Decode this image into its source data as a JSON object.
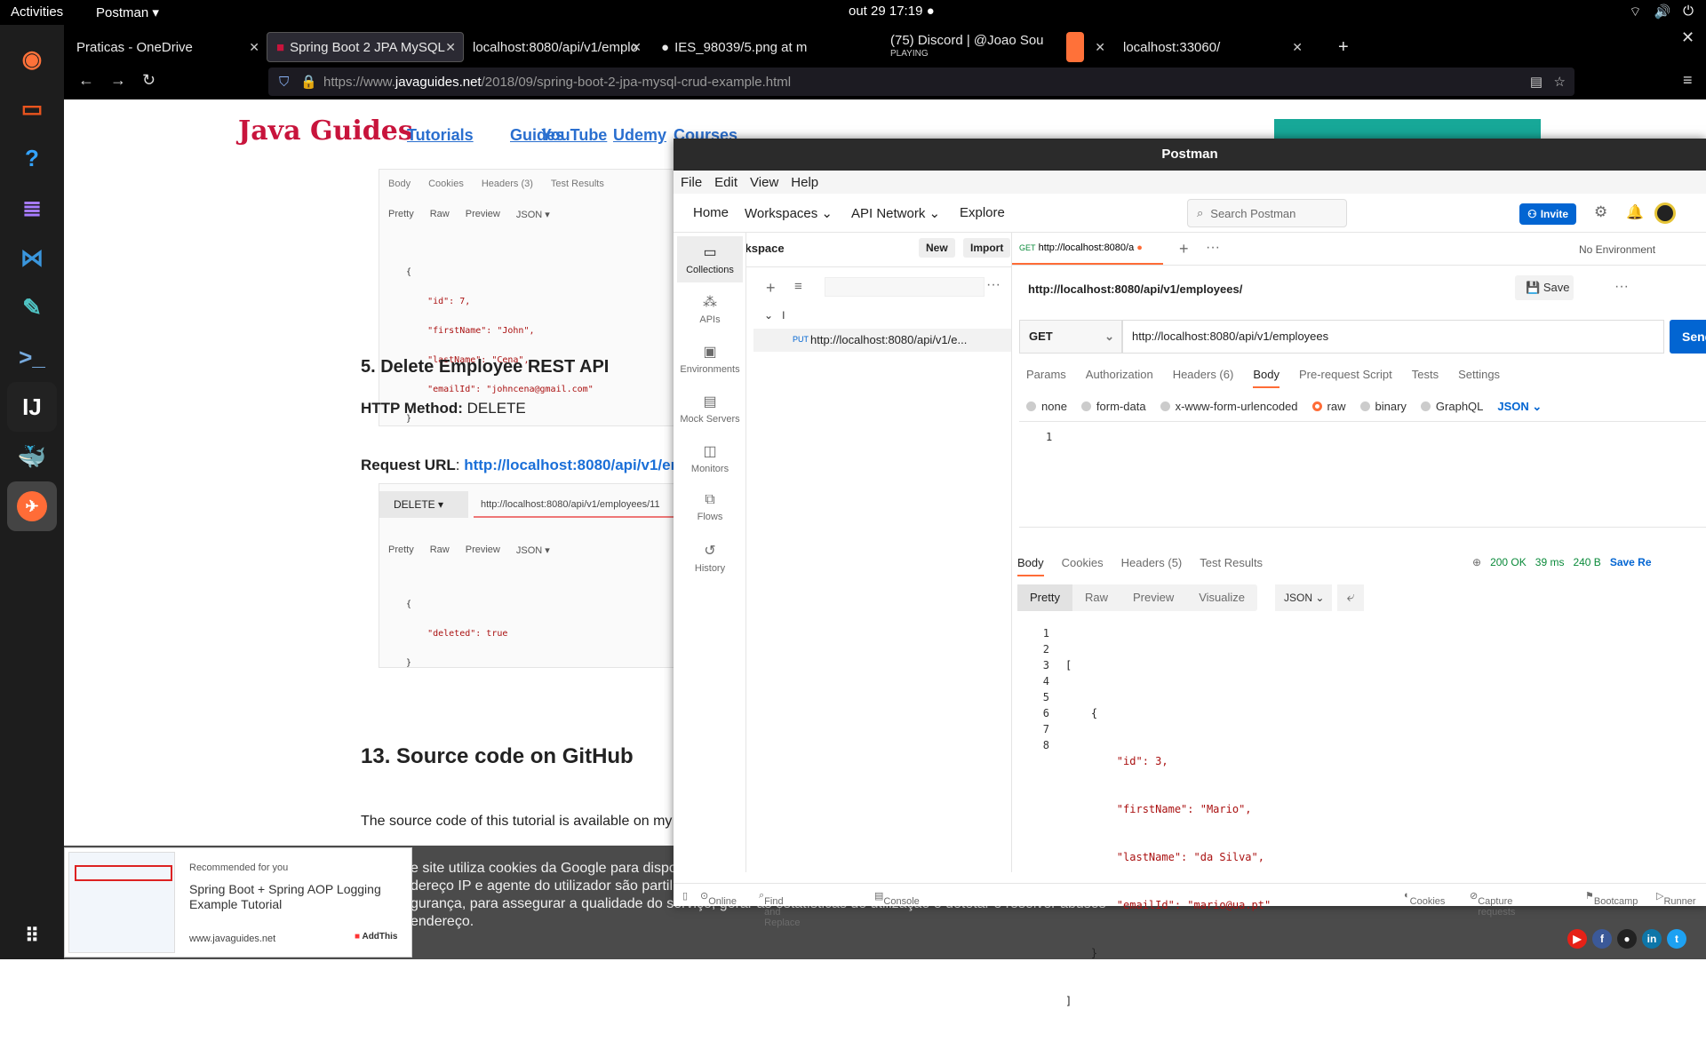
{
  "topbar": {
    "activities": "Activities",
    "app": "Postman ▾",
    "clock": "out 29  17:19  ●"
  },
  "tabs": [
    {
      "label": "Praticas - OneDrive"
    },
    {
      "label": "Spring Boot 2 JPA MySQL"
    },
    {
      "label": "localhost:8080/api/v1/emplo"
    },
    {
      "label": "IES_98039/5.png at m"
    },
    {
      "label": "(75) Discord | @Joao Sou",
      "sub": "PLAYING"
    },
    {
      "label": "localhost:33060/"
    }
  ],
  "url": {
    "prefix": "https://www.",
    "domain": "javaguides.net",
    "path": "/2018/09/spring-boot-2-jpa-mysql-crud-example.html"
  },
  "site": {
    "logo": "Java Guides",
    "nav": [
      "Tutorials",
      "Guides",
      "YouTube",
      "Udemy",
      "Courses"
    ],
    "shot1": {
      "tabs": [
        "Body",
        "Cookies",
        "Headers (3)",
        "Test Results"
      ],
      "modes": [
        "Pretty",
        "Raw",
        "Preview",
        "JSON ▾"
      ],
      "lines": [
        "{",
        "    \"id\": 7,",
        "    \"firstName\": \"John\",",
        "    \"lastName\": \"Cena\",",
        "    \"emailId\": \"johncena@gmail.com\"",
        "}"
      ]
    },
    "h_delete": "5. Delete Employee REST API",
    "http_method_label": "HTTP Method:",
    "http_method": "DELETE",
    "request_url_label": "Request URL",
    "request_url": "http://localhost:8080/api/v1/em",
    "shot2": {
      "method": "DELETE   ▾",
      "url": "http://localhost:8080/api/v1/employees/11",
      "modes": [
        "Pretty",
        "Raw",
        "Preview",
        "JSON ▾"
      ],
      "lines": [
        "{",
        "    \"deleted\": true",
        "}"
      ]
    },
    "h_source": "13. Source code on GitHub",
    "source_text": "The source code of this tutorial is available on my",
    "cookie": [
      "e site utiliza cookies da Google para dispo",
      "dereço IP e agente do utilizador são partil",
      "gurança, para assegurar a qualidade do serviço, gerar as estatísticas de utilização e detetar e resolver abusos",
      "endereço."
    ],
    "rec": {
      "label": "Recommended for you",
      "title": "Spring Boot + Spring AOP Logging Example Tutorial",
      "site": "www.javaguides.net",
      "addthis": "AddThis"
    }
  },
  "postman": {
    "title": "Postman",
    "menu": [
      "File",
      "Edit",
      "View",
      "Help"
    ],
    "top": {
      "home": "Home",
      "workspaces": "Workspaces ⌄",
      "api_network": "API Network ⌄",
      "explore": "Explore",
      "search": "Search Postman",
      "invite": "Invite"
    },
    "sidebar": [
      "Collections",
      "APIs",
      "Environments",
      "Mock Servers",
      "Monitors",
      "Flows",
      "History"
    ],
    "workspace": {
      "name": "My Workspace",
      "new": "New",
      "import": "Import",
      "folder": "I",
      "request_method": "PUT",
      "request_url": "http://localhost:8080/api/v1/e..."
    },
    "tab": {
      "method": "GET",
      "url": "http://localhost:8080/a",
      "no_env": "No Environment"
    },
    "breadcrumb": "http://localhost:8080/api/v1/employees/",
    "save": "Save",
    "request": {
      "method": "GET",
      "url": "http://localhost:8080/api/v1/employees",
      "send": "Send"
    },
    "req_tabs": [
      "Params",
      "Authorization",
      "Headers (6)",
      "Body",
      "Pre-request Script",
      "Tests",
      "Settings"
    ],
    "body_types": [
      "none",
      "form-data",
      "x-www-form-urlencoded",
      "raw",
      "binary",
      "GraphQL"
    ],
    "body_format": "JSON ⌄",
    "resp_tabs": [
      "Body",
      "Cookies",
      "Headers (5)",
      "Test Results"
    ],
    "resp_meta": {
      "status": "200 OK",
      "time": "39 ms",
      "size": "240 B",
      "save": "Save Re"
    },
    "resp_modes": [
      "Pretty",
      "Raw",
      "Preview",
      "Visualize"
    ],
    "resp_format": "JSON ⌄",
    "resp_lines": [
      "[",
      "    {",
      "        \"id\": 3,",
      "        \"firstName\": \"Mario\",",
      "        \"lastName\": \"da Silva\",",
      "        \"emailId\": \"mario@ua.pt\"",
      "    }",
      "]"
    ],
    "status_bar": [
      "Online",
      "Find and Replace",
      "Console",
      "Cookies",
      "Capture requests",
      "Bootcamp",
      "Runner"
    ]
  }
}
